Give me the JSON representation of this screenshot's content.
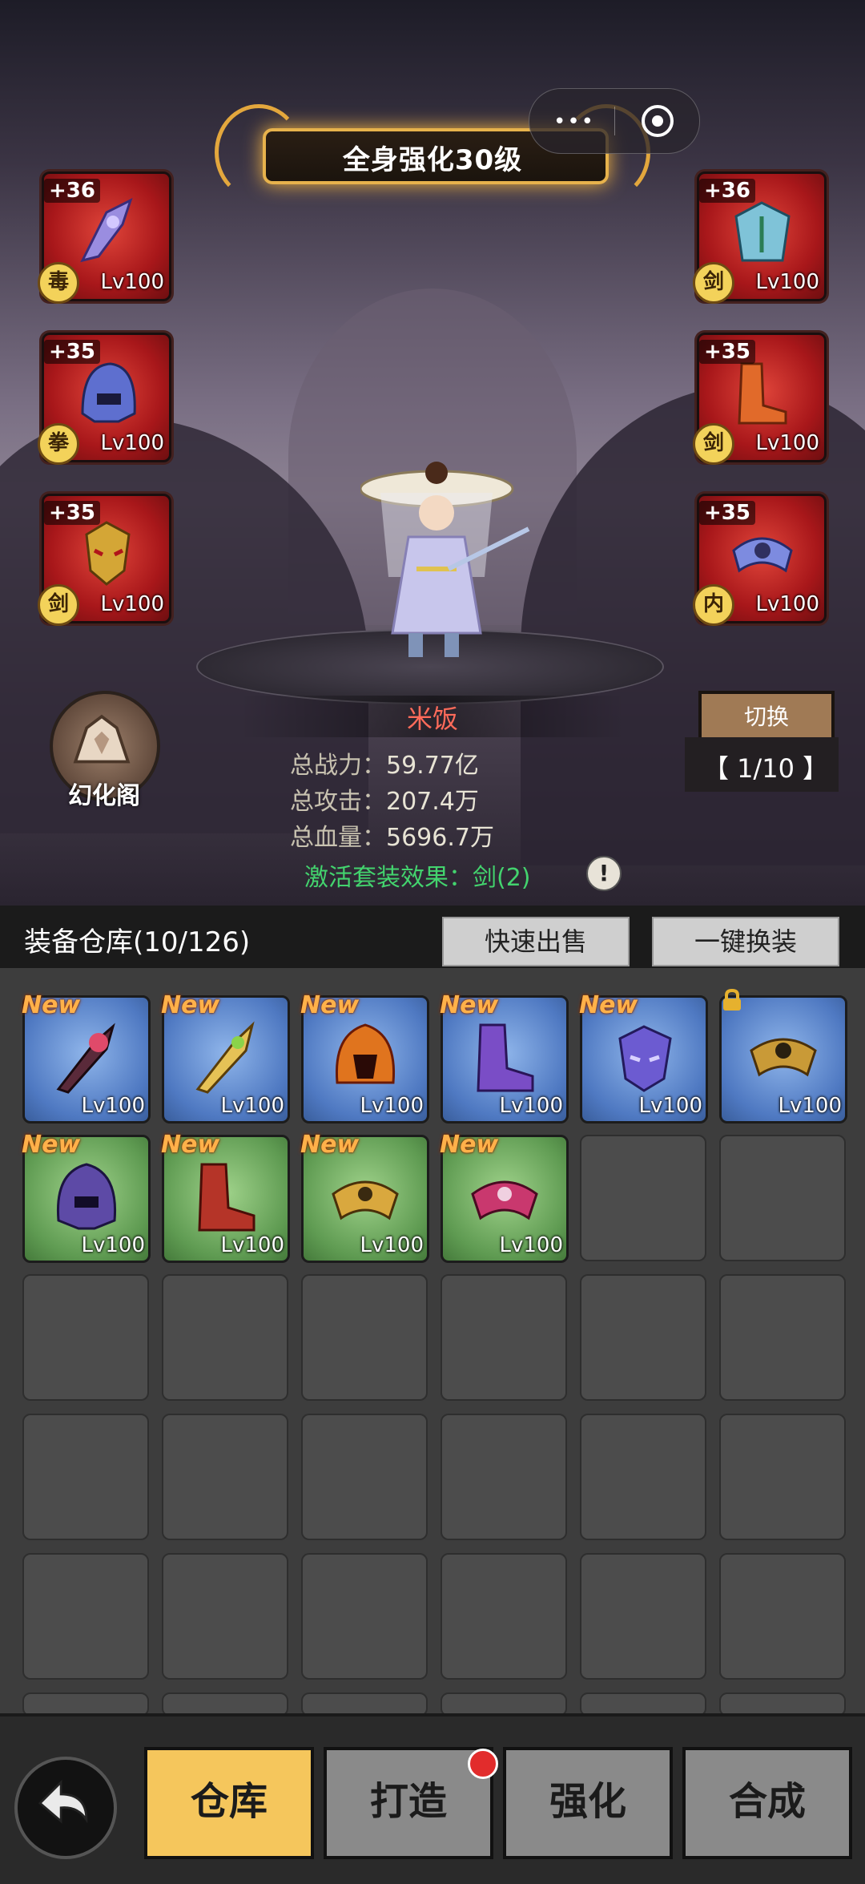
{
  "header": {
    "banner_title": "全身强化30级"
  },
  "capsule": {
    "menu_dots": "•••"
  },
  "equipment_slots": [
    {
      "plus": "+36",
      "type": "毒",
      "level": "Lv100"
    },
    {
      "plus": "+35",
      "type": "拳",
      "level": "Lv100"
    },
    {
      "plus": "+35",
      "type": "剑",
      "level": "Lv100"
    },
    {
      "plus": "+36",
      "type": "剑",
      "level": "Lv100"
    },
    {
      "plus": "+35",
      "type": "剑",
      "level": "Lv100"
    },
    {
      "plus": "+35",
      "type": "内",
      "level": "Lv100"
    }
  ],
  "character": {
    "name": "米饭",
    "power_label": "总战力：",
    "power_value": "59.77亿",
    "attack_label": "总攻击：",
    "attack_value": "207.4万",
    "hp_label": "总血量：",
    "hp_value": "5696.7万",
    "suit_effect": "激活套装效果：剑(2)",
    "info_icon": "!"
  },
  "huanhua": {
    "label": "幻化阁"
  },
  "switch": {
    "label": "切换",
    "page": "【 1/10 】"
  },
  "warehouse": {
    "title": "装备仓库(10/126)",
    "quick_sell": "快速出售",
    "one_click_equip": "一键换装"
  },
  "items": [
    {
      "rarity": "blue",
      "new": "New",
      "level": "Lv100"
    },
    {
      "rarity": "blue",
      "new": "New",
      "level": "Lv100"
    },
    {
      "rarity": "blue",
      "new": "New",
      "level": "Lv100"
    },
    {
      "rarity": "blue",
      "new": "New",
      "level": "Lv100"
    },
    {
      "rarity": "blue",
      "new": "New",
      "level": "Lv100"
    },
    {
      "rarity": "blue",
      "new": "",
      "level": "Lv100",
      "locked": true
    },
    {
      "rarity": "green",
      "new": "New",
      "level": "Lv100"
    },
    {
      "rarity": "green",
      "new": "New",
      "level": "Lv100"
    },
    {
      "rarity": "green",
      "new": "New",
      "level": "Lv100"
    },
    {
      "rarity": "green",
      "new": "New",
      "level": "Lv100"
    }
  ],
  "tabs": {
    "warehouse": "仓库",
    "forge": "打造",
    "enhance": "强化",
    "synthesize": "合成"
  },
  "colors": {
    "active_tab": "#f5c65c",
    "inactive_tab": "#8a8a8a",
    "blue_rarity": "#4f79c2",
    "green_rarity": "#5f9b52",
    "slot_red": "#a8171a",
    "name_red": "#ff6b5a",
    "suit_green": "#43d36e"
  }
}
